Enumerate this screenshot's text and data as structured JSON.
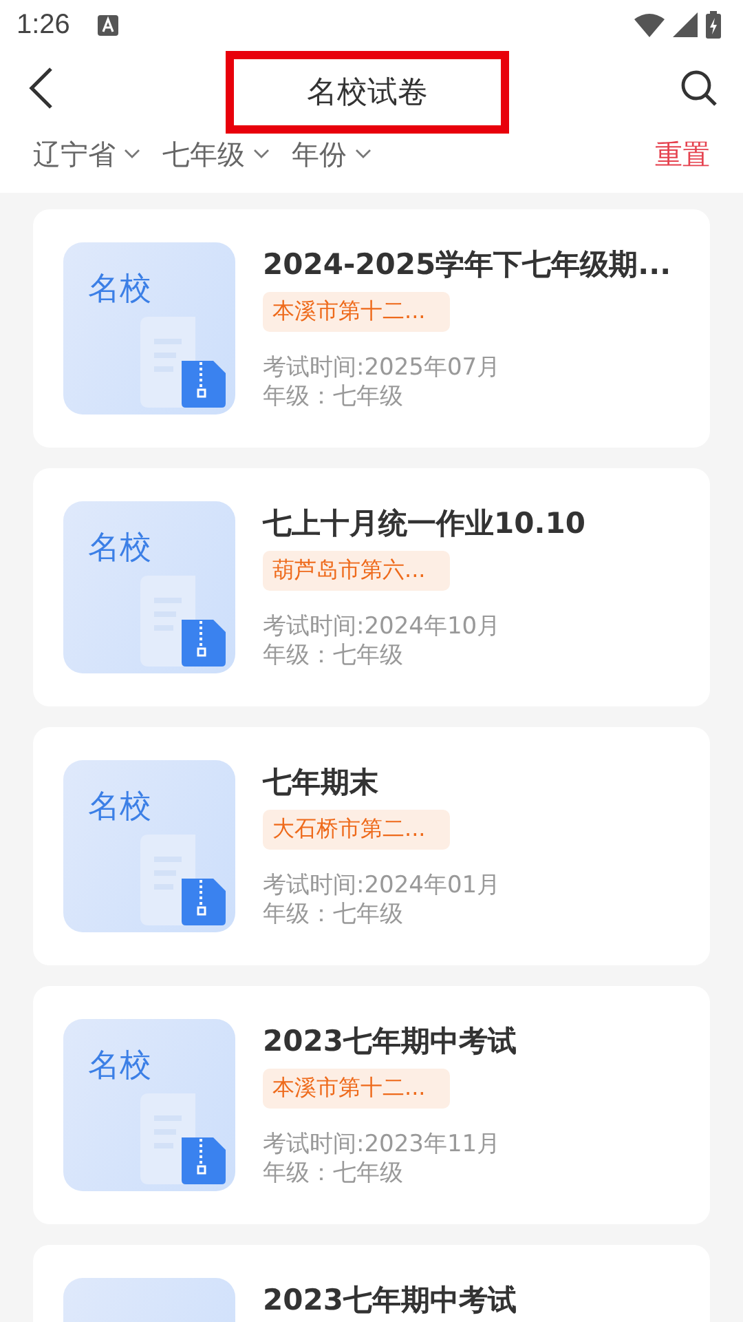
{
  "status_bar": {
    "time": "1:26"
  },
  "header": {
    "title": "名校试卷",
    "title_highlighted": true
  },
  "filters": [
    {
      "label": "辽宁省"
    },
    {
      "label": "七年级"
    },
    {
      "label": "年份"
    }
  ],
  "reset": "重置",
  "papers": [
    {
      "thumb_label": "名校",
      "title": "2024-2025学年下七年级期...",
      "school": "本溪市第十二...",
      "exam_time": "考试时间:2025年07月",
      "grade": "年级：七年级"
    },
    {
      "thumb_label": "名校",
      "title": "七上十月统一作业10.10",
      "school": "葫芦岛市第六...",
      "exam_time": "考试时间:2024年10月",
      "grade": "年级：七年级"
    },
    {
      "thumb_label": "名校",
      "title": "七年期末",
      "school": "大石桥市第二...",
      "exam_time": "考试时间:2024年01月",
      "grade": "年级：七年级"
    },
    {
      "thumb_label": "名校",
      "title": "2023七年期中考试",
      "school": "本溪市第十二...",
      "exam_time": "考试时间:2023年11月",
      "grade": "年级：七年级"
    },
    {
      "title": "2023七年期中考试"
    }
  ]
}
